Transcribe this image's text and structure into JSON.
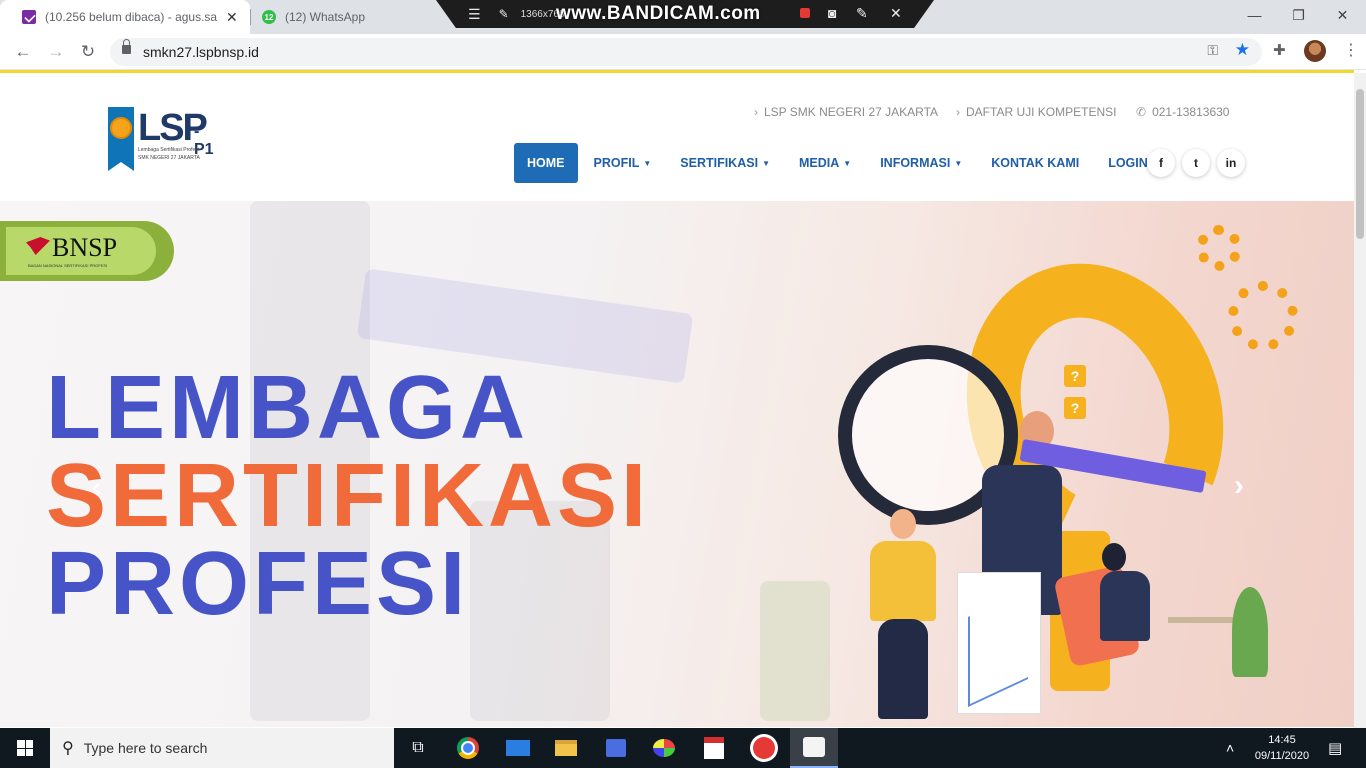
{
  "browser": {
    "tabs": [
      {
        "title": "(10.256 belum dibaca) - agus.sa",
        "icon": "gmail-icon",
        "active": true
      },
      {
        "title": "(12) WhatsApp",
        "icon": "whatsapp-icon",
        "badge": "12",
        "active": false
      }
    ],
    "tab_close": "✕",
    "url": "smkn27.lspbnsp.id",
    "recorder": {
      "resolution": "1366x768",
      "brand": "www.BANDICAM.com"
    }
  },
  "site": {
    "logo": {
      "text": "LSP",
      "suffix": "-P1",
      "sub1": "Lembaga Sertifikasi Profesi",
      "sub2": "SMK NEGERI 27 JAKARTA"
    },
    "top_links": [
      {
        "label": "LSP SMK NEGERI 27 JAKARTA",
        "prefix": "›"
      },
      {
        "label": "DAFTAR UJI KOMPETENSI",
        "prefix": "›"
      },
      {
        "label": "021-13813630",
        "prefix": "✆"
      }
    ],
    "nav": [
      {
        "label": "HOME",
        "caret": "",
        "active": true
      },
      {
        "label": "PROFIL",
        "caret": "▼"
      },
      {
        "label": "SERTIFIKASI",
        "caret": "▼"
      },
      {
        "label": "MEDIA",
        "caret": "▼"
      },
      {
        "label": "INFORMASI",
        "caret": "▼"
      },
      {
        "label": "KONTAK KAMI",
        "caret": ""
      },
      {
        "label": "LOGIN",
        "caret": ""
      }
    ],
    "social": [
      {
        "name": "facebook-icon",
        "glyph": "f"
      },
      {
        "name": "twitter-icon",
        "glyph": "t"
      },
      {
        "name": "linkedin-icon",
        "glyph": "in"
      }
    ]
  },
  "hero": {
    "badge": {
      "name": "BNSP",
      "tagline": "BADAN NASIONAL SERTIFIKASI PROFESI"
    },
    "line1": "LEMBAGA",
    "line2": "SERTIFIKASI",
    "line3": "PROFESI",
    "prev": "‹",
    "next": "›",
    "mini_q": "?",
    "colors": {
      "blue": "#4654c8",
      "orange": "#f06a3a",
      "accent": "#f5b21e"
    }
  },
  "taskbar": {
    "search_placeholder": "Type here to search",
    "time": "14:45",
    "date": "09/11/2020",
    "apps": [
      "task-view-icon",
      "chrome-icon",
      "mail-icon",
      "file-explorer-icon",
      "store-icon",
      "paint-icon",
      "acrobat-icon",
      "record-icon",
      "bandicam-icon"
    ]
  }
}
